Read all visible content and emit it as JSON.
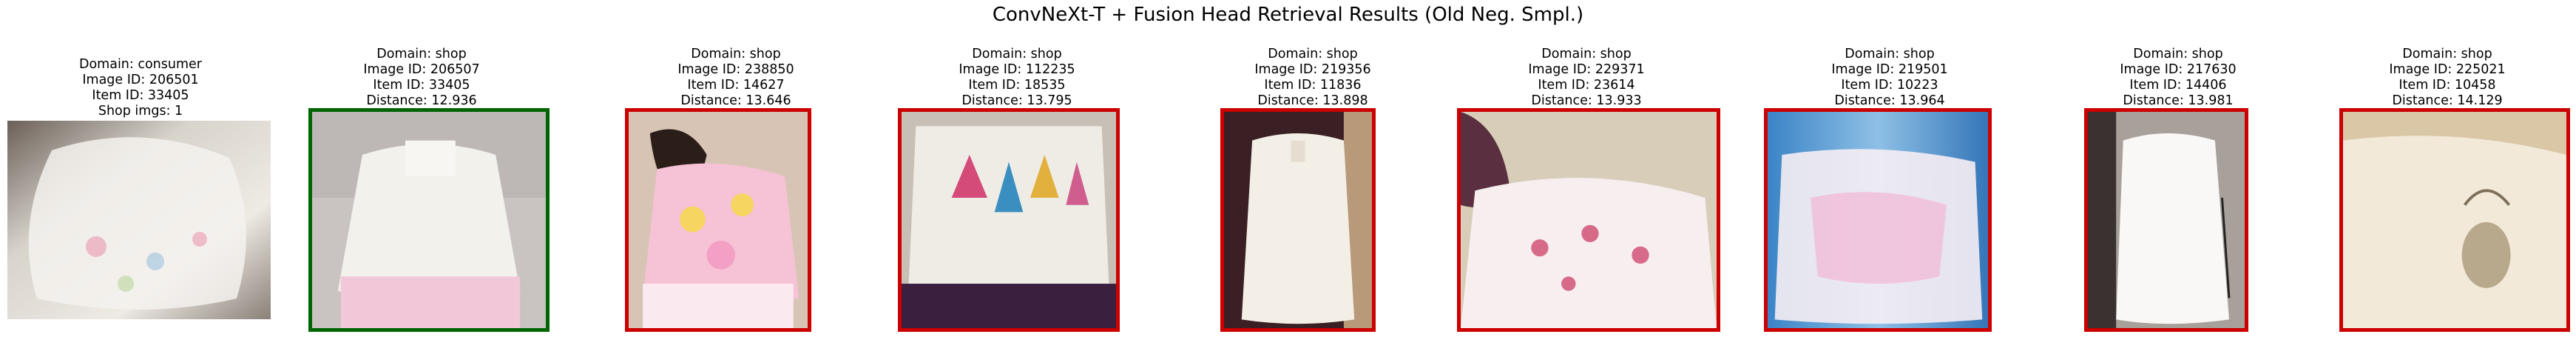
{
  "title": "ConvNeXt-T + Fusion Head Retrieval Results (Old Neg. Smpl.)",
  "query": {
    "domain": "Domain: consumer",
    "image_id": "Image ID: 206501",
    "item_id": "Item ID: 33405",
    "shop_imgs": "Shop imgs: 1"
  },
  "colors": {
    "match": "#006400",
    "mismatch": "#cc0000"
  },
  "results": [
    {
      "domain": "Domain: shop",
      "image_id": "Image ID: 206507",
      "item_id": "Item ID: 33405",
      "distance": "Distance: 12.936",
      "match": true
    },
    {
      "domain": "Domain: shop",
      "image_id": "Image ID: 238850",
      "item_id": "Item ID: 14627",
      "distance": "Distance: 13.646",
      "match": false
    },
    {
      "domain": "Domain: shop",
      "image_id": "Image ID: 112235",
      "item_id": "Item ID: 18535",
      "distance": "Distance: 13.795",
      "match": false
    },
    {
      "domain": "Domain: shop",
      "image_id": "Image ID: 219356",
      "item_id": "Item ID: 11836",
      "distance": "Distance: 13.898",
      "match": false
    },
    {
      "domain": "Domain: shop",
      "image_id": "Image ID: 229371",
      "item_id": "Item ID: 23614",
      "distance": "Distance: 13.933",
      "match": false
    },
    {
      "domain": "Domain: shop",
      "image_id": "Image ID: 219501",
      "item_id": "Item ID: 10223",
      "distance": "Distance: 13.964",
      "match": false
    },
    {
      "domain": "Domain: shop",
      "image_id": "Image ID: 217630",
      "item_id": "Item ID: 14406",
      "distance": "Distance: 13.981",
      "match": false
    },
    {
      "domain": "Domain: shop",
      "image_id": "Image ID: 225021",
      "item_id": "Item ID: 10458",
      "distance": "Distance: 14.129",
      "match": false
    }
  ]
}
